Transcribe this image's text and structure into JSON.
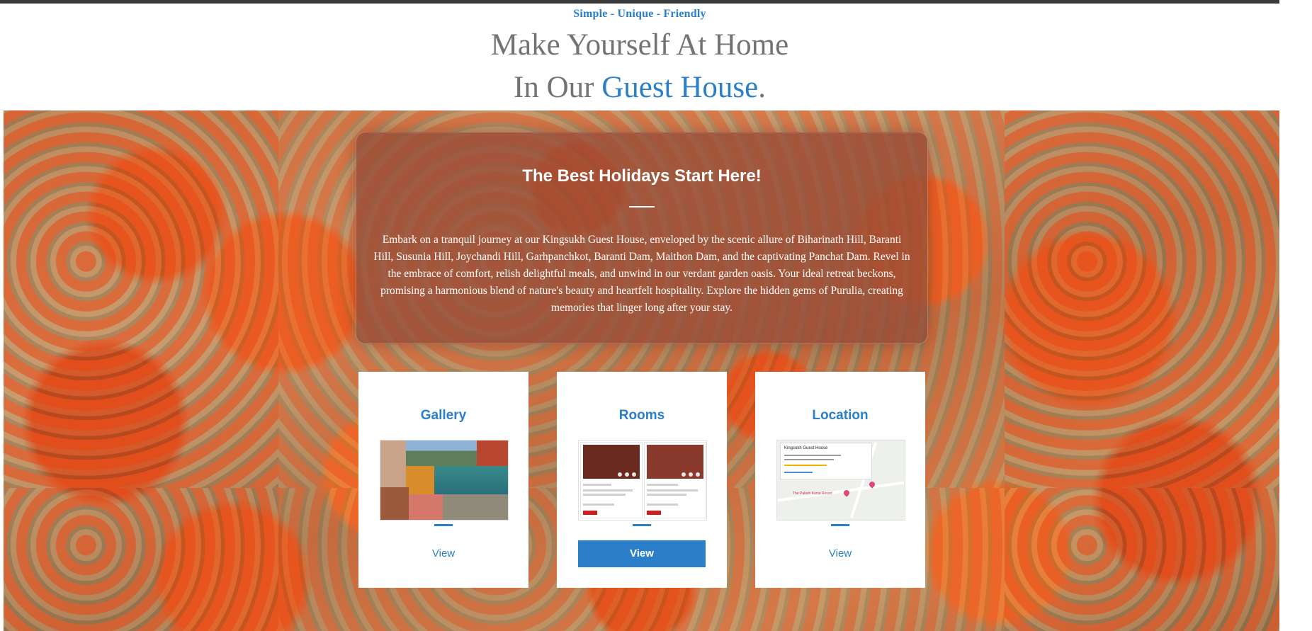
{
  "header": {
    "tagline": "Simple - Unique - Friendly",
    "title_line1": "Make Yourself At Home",
    "title_line2_prefix": "In Our ",
    "title_line2_accent": "Guest House",
    "title_line2_suffix": "."
  },
  "intro": {
    "heading": "The Best Holidays Start Here!",
    "body": "Embark on a tranquil journey at our Kingsukh Guest House, enveloped by the scenic allure of Biharinath Hill, Baranti Hill, Susunia Hill, Joychandi Hill, Garhpanchkot, Baranti Dam, Maithon Dam, and the captivating Panchat Dam. Revel in the embrace of comfort, relish delightful meals, and unwind in our verdant garden oasis. Your ideal retreat beckons, promising a harmonious blend of nature's beauty and heartfelt hospitality. Explore the hidden gems of Purulia, creating memories that linger long after your stay."
  },
  "cards": [
    {
      "title": "Gallery",
      "button": "View"
    },
    {
      "title": "Rooms",
      "button": "View"
    },
    {
      "title": "Location",
      "button": "View"
    }
  ],
  "map_thumb": {
    "place_name": "Kingsukh Guest House",
    "marker_label": "The Palash Kunja Resort"
  },
  "colors": {
    "accent": "#2a7fc8",
    "title_gray": "#737373",
    "overlay": "#96493a"
  }
}
